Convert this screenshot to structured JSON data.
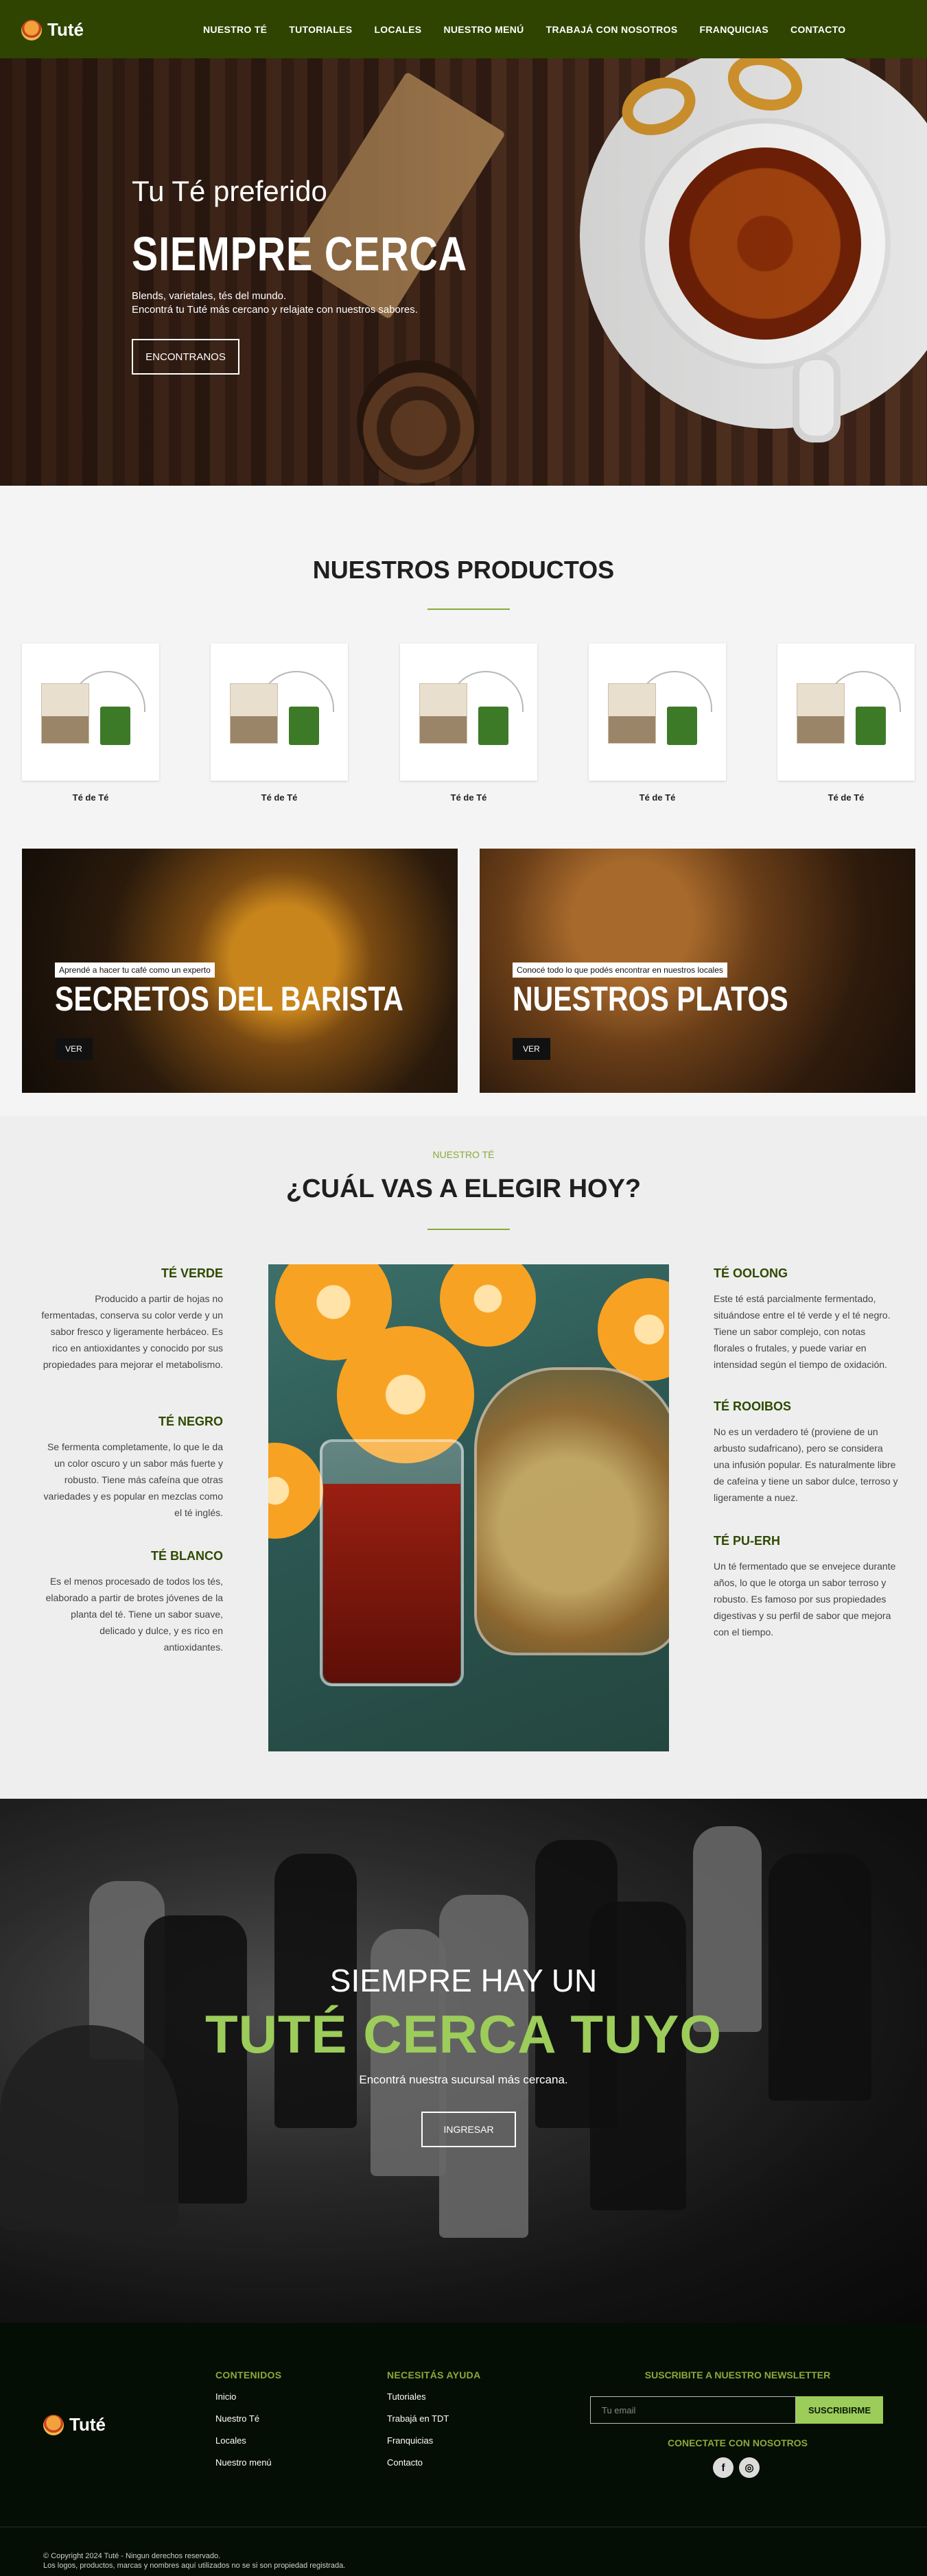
{
  "header": {
    "logo_text": "Tuté",
    "nav": [
      "NUESTRO TÉ",
      "TUTORIALES",
      "LOCALES",
      "NUESTRO MENÚ",
      "TRABAJÁ CON NOSOTROS",
      "FRANQUICIAS",
      "CONTACTO"
    ]
  },
  "hero": {
    "subtitle": "Tu Té preferido",
    "title": "SIEMPRE CERCA",
    "desc_line1": "Blends, varietales, tés del mundo.",
    "desc_line2": "Encontrá tu Tuté más cercano y relajate con nuestros sabores.",
    "button": "ENCONTRANOS"
  },
  "products": {
    "title": "NUESTROS PRODUCTOS",
    "items": [
      {
        "label": "Té de Té"
      },
      {
        "label": "Té de Té"
      },
      {
        "label": "Té de Té"
      },
      {
        "label": "Té de Té"
      },
      {
        "label": "Té de Té"
      }
    ]
  },
  "promos": [
    {
      "kicker": "Aprendé a hacer tu café como un experto",
      "title": "SECRETOS DEL BARISTA",
      "button": "VER"
    },
    {
      "kicker": "Conocé todo lo que podés encontrar en nuestros locales",
      "title": "NUESTROS PLATOS",
      "button": "VER"
    }
  ],
  "choose": {
    "kicker": "NUESTRO TÉ",
    "title": "¿CUÁL VAS A ELEGIR HOY?",
    "left": [
      {
        "name": "TÉ VERDE",
        "desc": "Producido a partir de hojas no fermentadas, conserva su color verde y un sabor fresco y ligeramente herbáceo. Es rico en antioxidantes y conocido por sus propiedades para mejorar el metabolismo."
      },
      {
        "name": "TÉ NEGRO",
        "desc": "Se fermenta completamente, lo que le da un color oscuro y un sabor más fuerte y robusto. Tiene más cafeína que otras variedades y es popular en mezclas como el té inglés."
      },
      {
        "name": "TÉ BLANCO",
        "desc": "Es el menos procesado de todos los tés, elaborado a partir de brotes jóvenes de la planta del té. Tiene un sabor suave, delicado y dulce, y es rico en antioxidantes."
      }
    ],
    "right": [
      {
        "name": "TÉ OOLONG",
        "desc": "Este té está parcialmente fermentado, situándose entre el té verde y el té negro. Tiene un sabor complejo, con notas florales o frutales, y puede variar en intensidad según el tiempo de oxidación."
      },
      {
        "name": "TÉ ROOIBOS",
        "desc": "No es un verdadero té (proviene de un arbusto sudafricano), pero se considera una infusión popular. Es naturalmente libre de cafeína y tiene un sabor dulce, terroso y ligeramente a nuez."
      },
      {
        "name": "TÉ PU-ERH",
        "desc": "Un té fermentado que se envejece durante años, lo que le otorga un sabor terroso y robusto. Es famoso por sus propiedades digestivas y su perfil de sabor que mejora con el tiempo."
      }
    ]
  },
  "cta": {
    "subtitle": "SIEMPRE HAY UN",
    "title": "TUTÉ CERCA TUYO",
    "desc": "Encontrá nuestra sucursal más cercana.",
    "button": "INGRESAR"
  },
  "footer": {
    "logo_text": "Tuté",
    "col1": {
      "title": "CONTENIDOS",
      "links": [
        "Inicio",
        "Nuestro Té",
        "Locales",
        "Nuestro menú"
      ]
    },
    "col2": {
      "title": "NECESITÁS AYUDA",
      "links": [
        "Tutoriales",
        "Trabajá en TDT",
        "Franquicias",
        "Contacto"
      ]
    },
    "newsletter_title": "SUSCRIBITE A NUESTRO NEWSLETTER",
    "email_placeholder": "Tu email",
    "subscribe_button": "SUSCRIBIRME",
    "social_title": "CONECTATE CON NOSOTROS",
    "social_icons": [
      "facebook-icon",
      "instagram-icon"
    ],
    "copyright1": "© Copyright 2024 Tuté - Ningun derechos reservado.",
    "copyright2": "Los logos, productos, marcas y nombres aquí utilizados no se si son propiedad registrada."
  },
  "colors": {
    "nav_bg": "#2e4400",
    "accent_green": "#8aa93a",
    "cta_green": "#9ccc5a",
    "footer_bg": "#050e04"
  }
}
